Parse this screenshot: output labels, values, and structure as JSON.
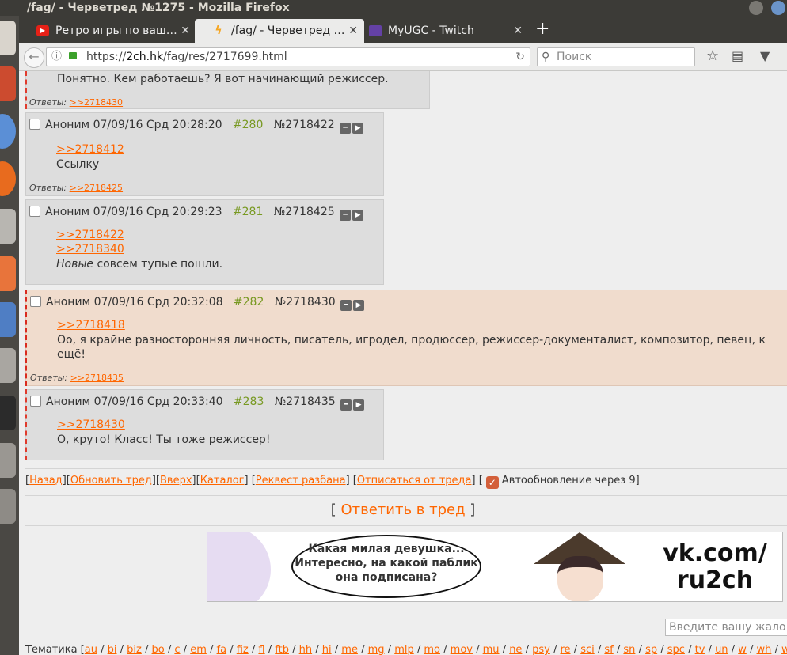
{
  "window": {
    "title": "/fag/ - Черветред №1275 - Mozilla Firefox"
  },
  "tabs": [
    {
      "label": "Ретро игры по ваш…",
      "icon": "youtube-icon",
      "color": "#e62117",
      "active": false
    },
    {
      "label": "/fag/ - Черветред …",
      "icon": "2ch-icon",
      "color": "#f5a623",
      "active": true
    },
    {
      "label": "MyUGC - Twitch",
      "icon": "twitch-icon",
      "color": "#6441a5",
      "active": false
    }
  ],
  "nav": {
    "url_prefix": "https://",
    "url_host": "2ch.hk",
    "url_path": "/fag/res/2717699.html",
    "search_placeholder": "Поиск"
  },
  "top_post": {
    "text": "Понятно. Кем работаешь? Я вот начинающий режиссер.",
    "replies_label": "Ответы:",
    "replies": [
      ">>2718430"
    ]
  },
  "posts": [
    {
      "author": "Аноним",
      "date": "07/09/16 Срд 20:28:20",
      "index": "#280",
      "num": "№2718422",
      "refs": [
        ">>2718412"
      ],
      "text": "Ссылку",
      "replies_label": "Ответы:",
      "replies": [
        ">>2718425"
      ]
    },
    {
      "author": "Аноним",
      "date": "07/09/16 Срд 20:29:23",
      "index": "#281",
      "num": "№2718425",
      "refs": [
        ">>2718422",
        ">>2718340"
      ],
      "text_em": "Новые",
      "text": "совсем тупые пошли."
    },
    {
      "author": "Аноним",
      "date": "07/09/16 Срд 20:32:08",
      "index": "#282",
      "num": "№2718430",
      "refs": [
        ">>2718418"
      ],
      "text": "Оо, я крайне разносторонняя личность, писатель, игродел, продюссер, режиссер-документалист, композитор, певец, к",
      "text2": "ещё!",
      "replies_label": "Ответы:",
      "replies": [
        ">>2718435"
      ]
    },
    {
      "author": "Аноним",
      "date": "07/09/16 Срд 20:33:40",
      "index": "#283",
      "num": "№2718435",
      "refs": [
        ">>2718430"
      ],
      "text": "О, круто! Класс! Ты тоже режиссер!"
    }
  ],
  "thread_nav": {
    "back": "Назад",
    "refresh": "Обновить тред",
    "up": "Вверх",
    "catalog": "Каталог",
    "request": "Реквест разбана",
    "unsubscribe": "Отписаться от треда",
    "autoupdate": "Автообновление через 9"
  },
  "reply": {
    "label": "Ответить в тред"
  },
  "banner": {
    "bubble": [
      "Какая милая девушка...",
      "Интересно, на какой паблик",
      "она подписана?"
    ],
    "vk": [
      "vk.com/",
      "ru2ch"
    ]
  },
  "complaint_placeholder": "Введите вашу жало",
  "boards": {
    "label": "Тематика [",
    "items": [
      "au",
      "bi",
      "biz",
      "bo",
      "c",
      "em",
      "fa",
      "fiz",
      "fl",
      "ftb",
      "hh",
      "hi",
      "me",
      "mg",
      "mlp",
      "mo",
      "mov",
      "mu",
      "ne",
      "psy",
      "re",
      "sci",
      "sf",
      "sn",
      "sp",
      "spc",
      "tv",
      "un",
      "w",
      "wh",
      "wm"
    ]
  },
  "colors": {
    "link": "#ff6600",
    "post_index": "#789922",
    "highlight": "#f0dccd",
    "post_bg": "#dddddd"
  }
}
